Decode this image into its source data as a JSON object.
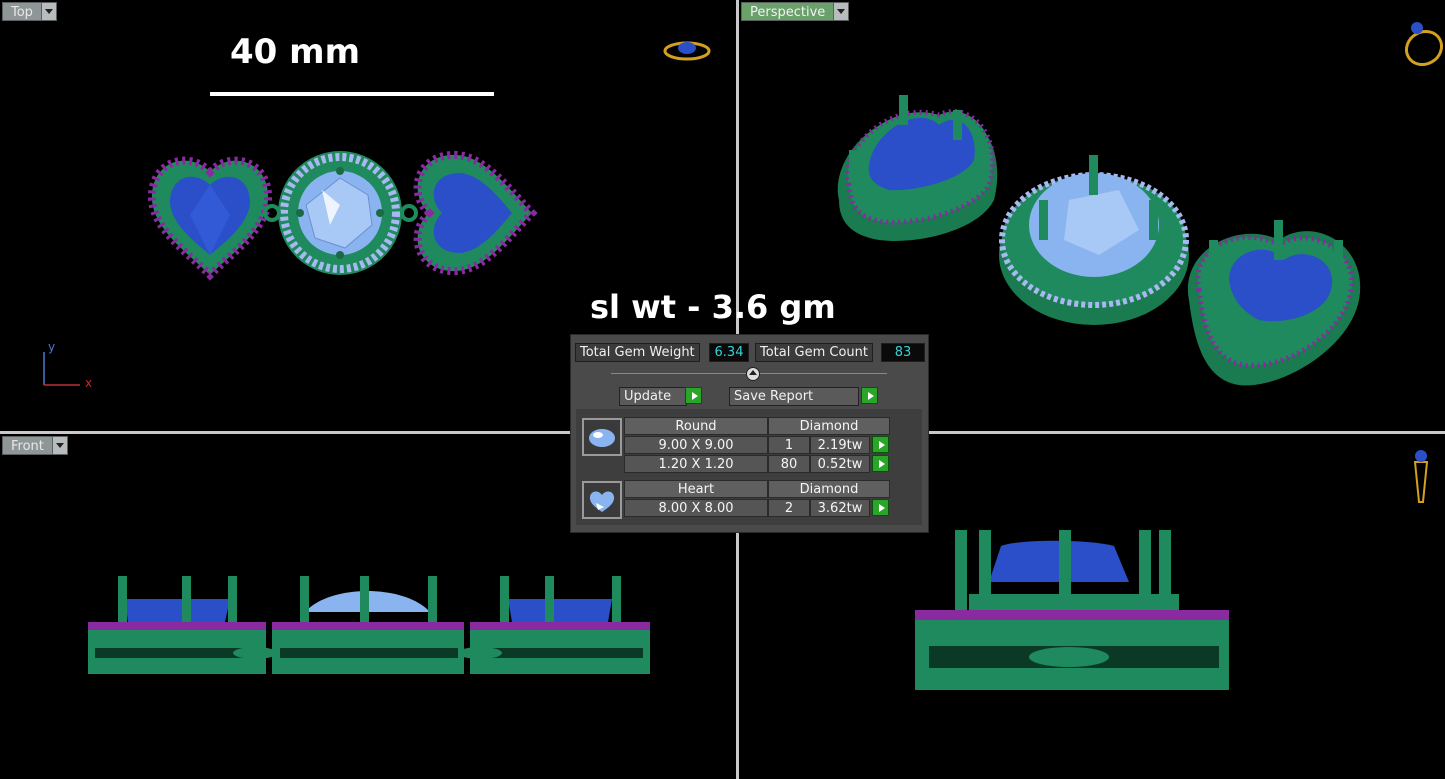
{
  "viewports": {
    "top": {
      "label": "Top"
    },
    "perspective": {
      "label": "Perspective"
    },
    "front": {
      "label": "Front"
    }
  },
  "annotations": {
    "scale_label": "40 mm",
    "silver_weight": "sl wt - 3.6 gm"
  },
  "axis": {
    "y": "y",
    "x": "x"
  },
  "gem_panel": {
    "total_weight_label": "Total Gem Weight",
    "total_weight_value": "6.34",
    "total_count_label": "Total Gem Count",
    "total_count_value": "83",
    "update_label": "Update",
    "save_report_label": "Save Report",
    "groups": [
      {
        "shape": "Round",
        "material": "Diamond",
        "rows": [
          {
            "size": "9.00 X 9.00",
            "count": "1",
            "weight": "2.19tw"
          },
          {
            "size": "1.20 X 1.20",
            "count": "80",
            "weight": "0.52tw"
          }
        ]
      },
      {
        "shape": "Heart",
        "material": "Diamond",
        "rows": [
          {
            "size": "8.00 X 8.00",
            "count": "2",
            "weight": "3.62tw"
          }
        ]
      }
    ]
  },
  "colors": {
    "metal": "#1f8a5e",
    "sapphire": "#2a4fc8",
    "center_stone": "#8ab4f0",
    "accent_gem": "#a8b8f0",
    "bead": "#8a2aa0",
    "gnomon": "#d4a020"
  }
}
